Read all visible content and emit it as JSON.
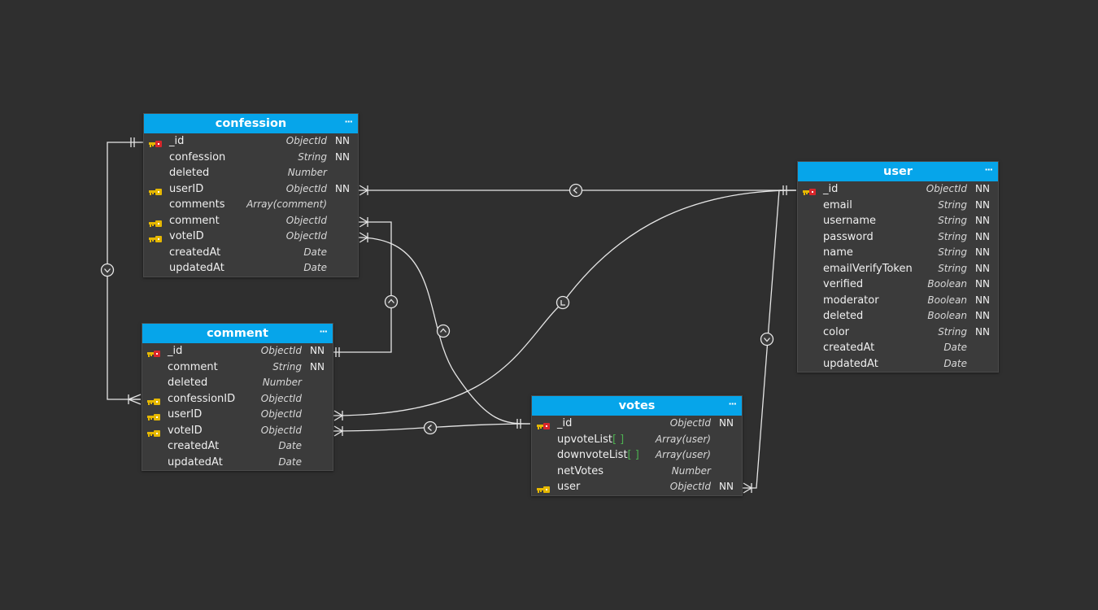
{
  "tables": {
    "confession": {
      "title": "confession",
      "menu": "···",
      "fields": [
        {
          "name": "_id",
          "type": "ObjectId",
          "nn": "NN",
          "key": "pk"
        },
        {
          "name": "confession",
          "type": "String",
          "nn": "NN",
          "key": ""
        },
        {
          "name": "deleted",
          "type": "Number",
          "nn": "",
          "key": ""
        },
        {
          "name": "userID",
          "type": "ObjectId",
          "nn": "NN",
          "key": "fk"
        },
        {
          "name": "comments",
          "type": "Array(comment)",
          "nn": "",
          "key": ""
        },
        {
          "name": "comment",
          "type": "ObjectId",
          "nn": "",
          "key": "fk"
        },
        {
          "name": "voteID",
          "type": "ObjectId",
          "nn": "",
          "key": "fk"
        },
        {
          "name": "createdAt",
          "type": "Date",
          "nn": "",
          "key": ""
        },
        {
          "name": "updatedAt",
          "type": "Date",
          "nn": "",
          "key": ""
        }
      ]
    },
    "comment": {
      "title": "comment",
      "menu": "···",
      "fields": [
        {
          "name": "_id",
          "type": "ObjectId",
          "nn": "NN",
          "key": "pk"
        },
        {
          "name": "comment",
          "type": "String",
          "nn": "NN",
          "key": ""
        },
        {
          "name": "deleted",
          "type": "Number",
          "nn": "",
          "key": ""
        },
        {
          "name": "confessionID",
          "type": "ObjectId",
          "nn": "",
          "key": "fk"
        },
        {
          "name": "userID",
          "type": "ObjectId",
          "nn": "",
          "key": "fk"
        },
        {
          "name": "voteID",
          "type": "ObjectId",
          "nn": "",
          "key": "fk"
        },
        {
          "name": "createdAt",
          "type": "Date",
          "nn": "",
          "key": ""
        },
        {
          "name": "updatedAt",
          "type": "Date",
          "nn": "",
          "key": ""
        }
      ]
    },
    "user": {
      "title": "user",
      "menu": "···",
      "fields": [
        {
          "name": "_id",
          "type": "ObjectId",
          "nn": "NN",
          "key": "pk"
        },
        {
          "name": "email",
          "type": "String",
          "nn": "NN",
          "key": ""
        },
        {
          "name": "username",
          "type": "String",
          "nn": "NN",
          "key": ""
        },
        {
          "name": "password",
          "type": "String",
          "nn": "NN",
          "key": ""
        },
        {
          "name": "name",
          "type": "String",
          "nn": "NN",
          "key": ""
        },
        {
          "name": "emailVerifyToken",
          "type": "String",
          "nn": "NN",
          "key": ""
        },
        {
          "name": "verified",
          "type": "Boolean",
          "nn": "NN",
          "key": ""
        },
        {
          "name": "moderator",
          "type": "Boolean",
          "nn": "NN",
          "key": ""
        },
        {
          "name": "deleted",
          "type": "Boolean",
          "nn": "NN",
          "key": ""
        },
        {
          "name": "color",
          "type": "String",
          "nn": "NN",
          "key": ""
        },
        {
          "name": "createdAt",
          "type": "Date",
          "nn": "",
          "key": ""
        },
        {
          "name": "updatedAt",
          "type": "Date",
          "nn": "",
          "key": ""
        }
      ]
    },
    "votes": {
      "title": "votes",
      "menu": "···",
      "fields": [
        {
          "name": "_id",
          "type": "ObjectId",
          "nn": "NN",
          "key": "pk"
        },
        {
          "name": "upvoteList",
          "bracket": "[ ]",
          "type": "Array(user)",
          "nn": "",
          "key": ""
        },
        {
          "name": "downvoteList",
          "bracket": "[ ]",
          "type": "Array(user)",
          "nn": "",
          "key": ""
        },
        {
          "name": "netVotes",
          "type": "Number",
          "nn": "",
          "key": ""
        },
        {
          "name": "user",
          "type": "ObjectId",
          "nn": "NN",
          "key": "fk"
        }
      ]
    }
  },
  "colors": {
    "background": "#2f2f2f",
    "header": "#06a5ea",
    "primary_key": "#d9262b",
    "foreign_key": "#e6b800",
    "array_bracket": "#4caf50"
  }
}
